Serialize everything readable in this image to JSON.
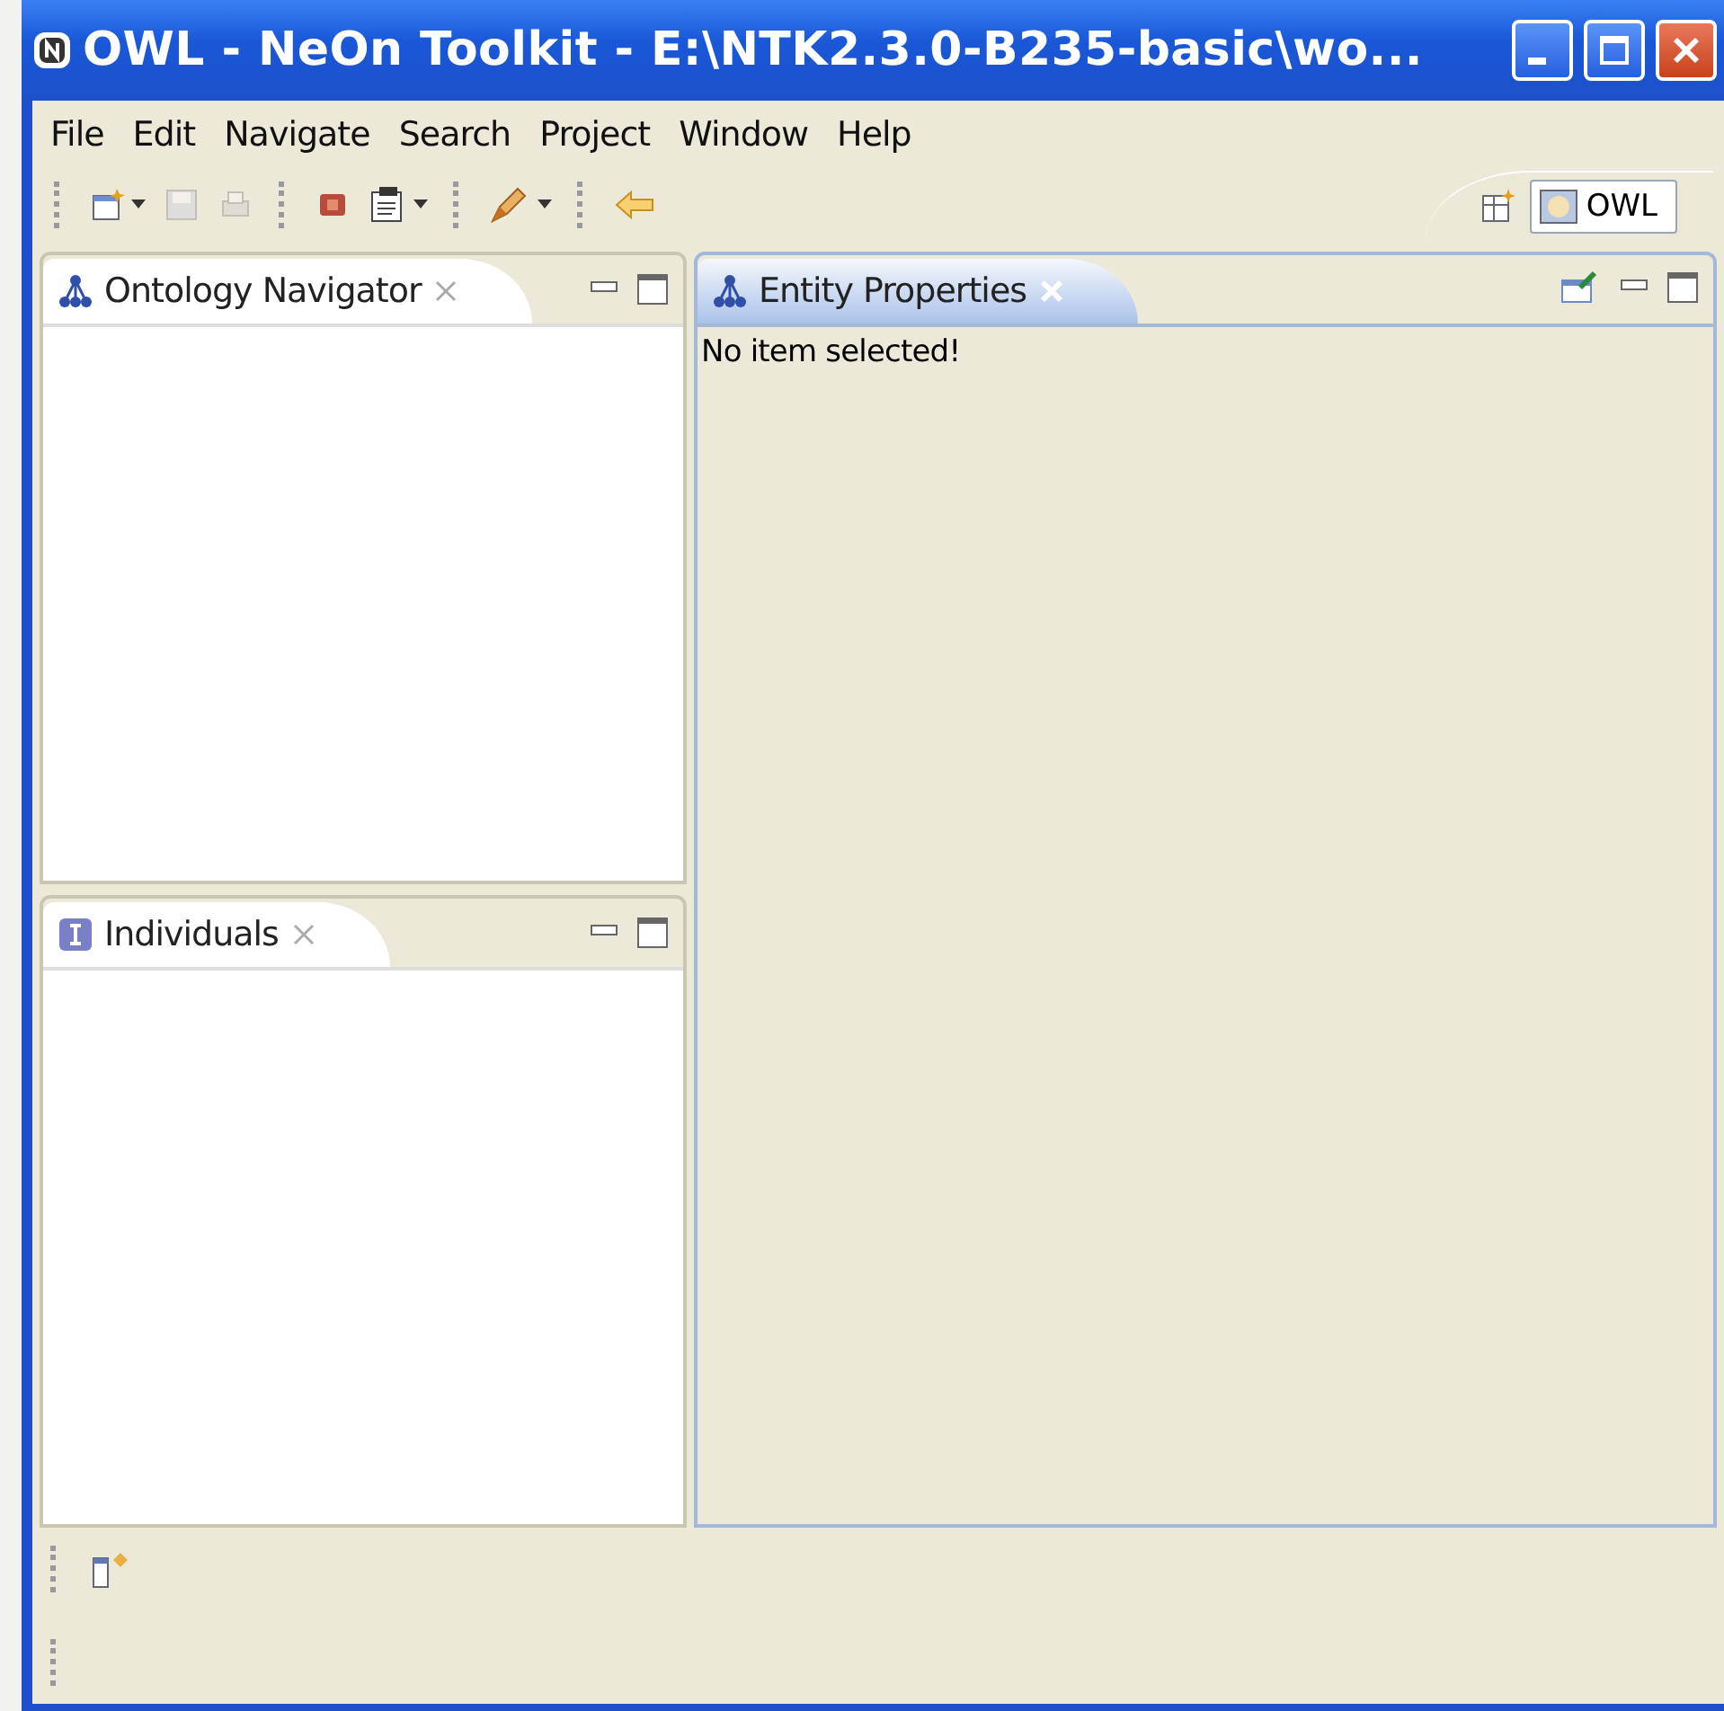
{
  "window": {
    "title": "OWL - NeOn Toolkit - E:\\NTK2.3.0-B235-basic\\wo..."
  },
  "menu": [
    {
      "label": "File"
    },
    {
      "label": "Edit"
    },
    {
      "label": "Navigate"
    },
    {
      "label": "Search"
    },
    {
      "label": "Project"
    },
    {
      "label": "Window"
    },
    {
      "label": "Help"
    }
  ],
  "toolbar": [
    {
      "kind": "sep"
    },
    {
      "kind": "new",
      "dropdown": true,
      "disabled": false
    },
    {
      "kind": "save",
      "dropdown": false,
      "disabled": true
    },
    {
      "kind": "print",
      "dropdown": false,
      "disabled": true
    },
    {
      "kind": "sep"
    },
    {
      "kind": "stop",
      "dropdown": false,
      "disabled": false
    },
    {
      "kind": "ms",
      "dropdown": true,
      "disabled": false
    },
    {
      "kind": "sep"
    },
    {
      "kind": "pen",
      "dropdown": true,
      "disabled": false
    },
    {
      "kind": "sep"
    },
    {
      "kind": "back",
      "dropdown": false,
      "disabled": false
    }
  ],
  "perspectives": [
    {
      "label": "OWL",
      "selected": true
    }
  ],
  "views": {
    "left_top": {
      "title": "Ontology Navigator",
      "selected": false
    },
    "left_bottom": {
      "title": "Individuals",
      "selected": false
    },
    "right": {
      "title": "Entity Properties",
      "selected": true,
      "message": "No item selected!"
    }
  }
}
